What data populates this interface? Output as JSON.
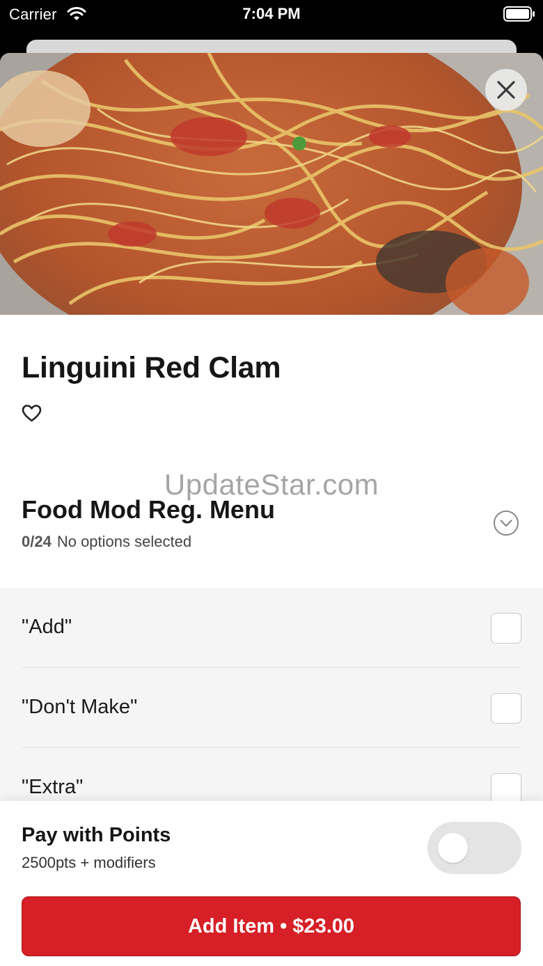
{
  "status_bar": {
    "carrier": "Carrier",
    "time": "7:04 PM"
  },
  "item": {
    "title": "Linguini Red Clam"
  },
  "watermark": "UpdateStar.com",
  "modifier_group": {
    "title": "Food Mod Reg. Menu",
    "count": "0/24",
    "status": "No options selected"
  },
  "options": [
    {
      "label": "\"Add\"",
      "checked": false
    },
    {
      "label": "\"Don't Make\"",
      "checked": false
    },
    {
      "label": "\"Extra\"",
      "checked": false
    }
  ],
  "footer": {
    "pay_title": "Pay with Points",
    "pay_sub": "2500pts + modifiers",
    "pay_toggle_on": false,
    "add_button": "Add Item • $23.00"
  },
  "colors": {
    "accent": "#d61f26",
    "options_bg": "#f5f5f5"
  },
  "icons": [
    "wifi-icon",
    "battery-icon",
    "close-icon",
    "heart-icon",
    "chevron-down-icon"
  ]
}
